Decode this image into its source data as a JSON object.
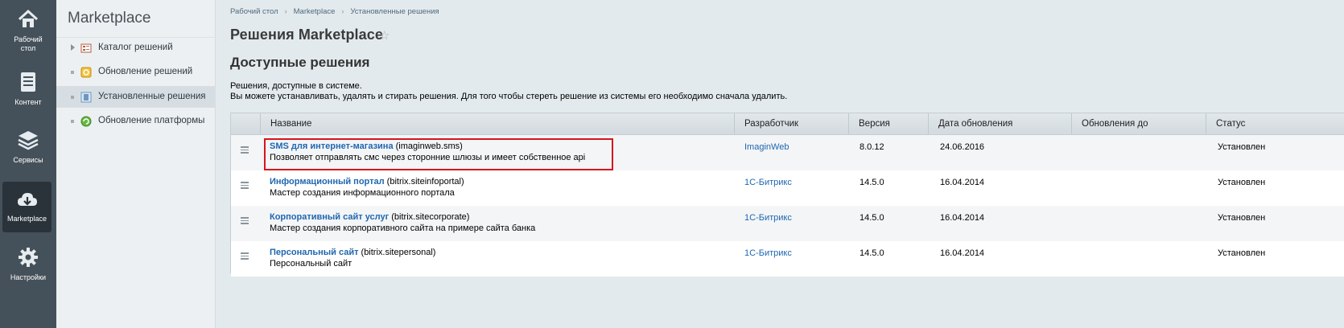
{
  "leftbar": {
    "items": [
      {
        "label": "Рабочий стол",
        "icon": "home-icon"
      },
      {
        "label": "Контент",
        "icon": "document-icon"
      },
      {
        "label": "Сервисы",
        "icon": "layers-icon"
      },
      {
        "label": "Marketplace",
        "icon": "cloud-download-icon"
      },
      {
        "label": "Настройки",
        "icon": "gear-icon"
      }
    ]
  },
  "menu": {
    "title": "Marketplace",
    "items": [
      {
        "label": "Каталог решений"
      },
      {
        "label": "Обновление решений"
      },
      {
        "label": "Установленные решения"
      },
      {
        "label": "Обновление платформы"
      }
    ]
  },
  "breadcrumb": [
    "Рабочий стол",
    "Marketplace",
    "Установленные решения"
  ],
  "page": {
    "title": "Решения Marketplace",
    "subtitle": "Доступные решения",
    "desc1": "Решения, доступные в системе.",
    "desc2": "Вы можете устанавливать, удалять и стирать решения. Для того чтобы стереть решение из системы его необходимо сначала удалить."
  },
  "table": {
    "headers": [
      "Название",
      "Разработчик",
      "Версия",
      "Дата обновления",
      "Обновления до",
      "Статус"
    ],
    "rows": [
      {
        "name": "SMS для интернет-магазина",
        "code": "(imaginweb.sms)",
        "desc": "Позволяет отправлять смс через сторонние шлюзы и имеет собственное api",
        "developer": "ImaginWeb",
        "version": "8.0.12",
        "date": "24.06.2016",
        "updates_to": "",
        "status": "Установлен"
      },
      {
        "name": "Информационный портал",
        "code": "(bitrix.siteinfoportal)",
        "desc": "Мастер создания информационного портала",
        "developer": "1С-Битрикс",
        "version": "14.5.0",
        "date": "16.04.2014",
        "updates_to": "",
        "status": "Установлен"
      },
      {
        "name": "Корпоративный сайт услуг",
        "code": "(bitrix.sitecorporate)",
        "desc": "Мастер создания корпоративного сайта на примере сайта банка",
        "developer": "1С-Битрикс",
        "version": "14.5.0",
        "date": "16.04.2014",
        "updates_to": "",
        "status": "Установлен"
      },
      {
        "name": "Персональный сайт",
        "code": "(bitrix.sitepersonal)",
        "desc": "Персональный сайт",
        "developer": "1С-Битрикс",
        "version": "14.5.0",
        "date": "16.04.2014",
        "updates_to": "",
        "status": "Установлен"
      }
    ]
  },
  "colors": {
    "accent_link": "#2067b0",
    "highlight_border": "#d7141f",
    "leftbar_bg": "#45515a"
  }
}
